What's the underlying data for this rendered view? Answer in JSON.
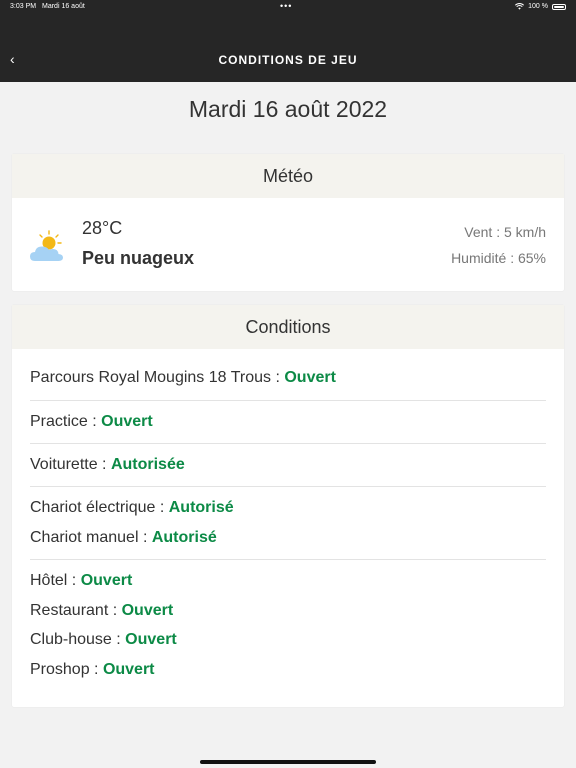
{
  "status_bar": {
    "time": "3:03 PM",
    "date": "Mardi 16 août",
    "dots": "•••",
    "battery": "100 %"
  },
  "nav": {
    "back": "‹",
    "title": "CONDITIONS DE JEU"
  },
  "page": {
    "date": "Mardi 16 août 2022"
  },
  "meteo": {
    "header": "Météo",
    "icon": "partly-cloudy-icon",
    "temperature": "28°C",
    "description": "Peu nuageux",
    "wind": "Vent : 5 km/h",
    "humidity": "Humidité : 65%"
  },
  "conditions": {
    "header": "Conditions",
    "rows": [
      {
        "label": "Parcours Royal Mougins 18 Trous :",
        "value": "Ouvert"
      },
      {
        "label": "Practice  :",
        "value": "Ouvert"
      },
      {
        "label": "Voiturette  :",
        "value": "Autorisée"
      },
      {
        "label": "Chariot électrique  :",
        "value": "Autorisé"
      },
      {
        "label": "Chariot manuel  :",
        "value": "Autorisé"
      },
      {
        "label": "Hôtel  :",
        "value": "Ouvert"
      },
      {
        "label": "Restaurant  :",
        "value": "Ouvert"
      },
      {
        "label": "Club-house  :",
        "value": "Ouvert"
      },
      {
        "label": "Proshop  :",
        "value": "Ouvert"
      }
    ]
  },
  "colors": {
    "top_bar": "#262626",
    "open_green": "#0c8a46",
    "header_bg": "#f4f3ee"
  }
}
